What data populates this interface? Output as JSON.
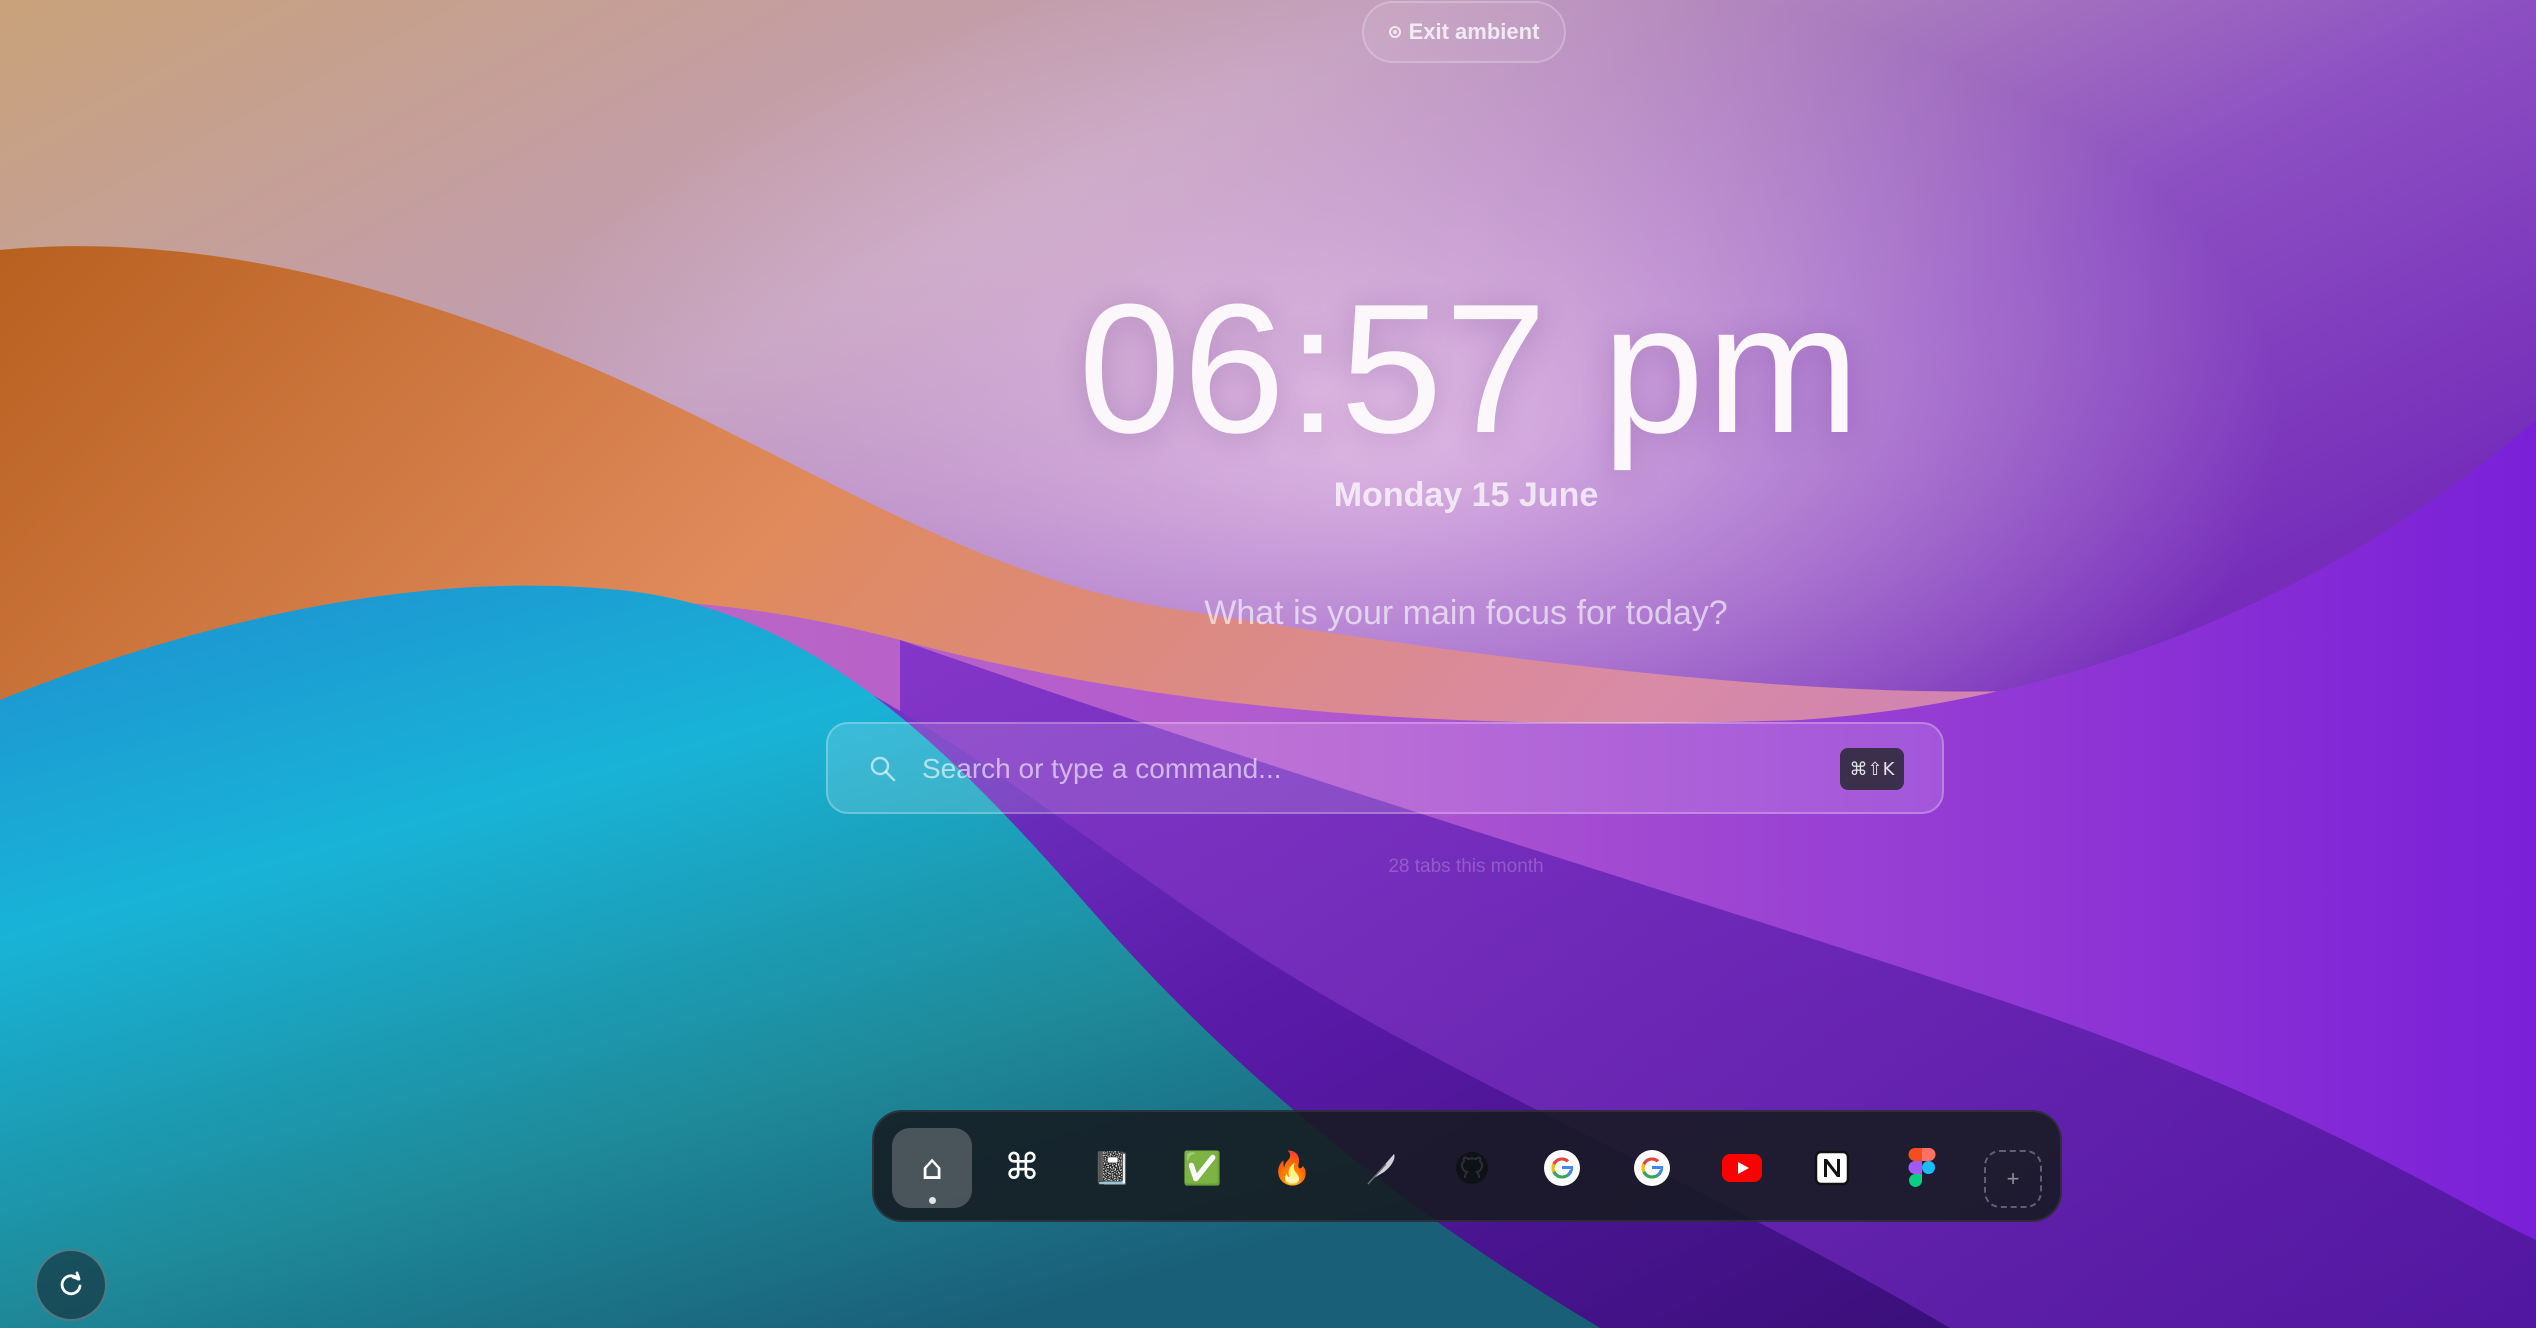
{
  "exit_ambient": {
    "label": "Exit ambient",
    "icon": "circle-dot-icon"
  },
  "clock": {
    "time": "06:57 pm",
    "date": "Monday 15 June"
  },
  "focus": {
    "prompt": "What is your main focus for today?"
  },
  "search": {
    "placeholder": "Search or type a command...",
    "shortcut": "⌘⇧K",
    "icon": "search-icon"
  },
  "stats": {
    "tabs_text": "28 tabs this month"
  },
  "dock": {
    "items": [
      {
        "name": "home",
        "icon": "home-icon",
        "glyph": "⌂",
        "active": true
      },
      {
        "name": "command",
        "icon": "command-icon",
        "glyph": "⌘"
      },
      {
        "name": "notebook",
        "icon": "notebook-icon",
        "glyph": "📓"
      },
      {
        "name": "tasks",
        "icon": "check-box-icon",
        "glyph": "✅"
      },
      {
        "name": "fire",
        "icon": "fire-icon",
        "glyph": "🔥"
      },
      {
        "name": "quill",
        "icon": "quill-icon",
        "glyph": "🪶"
      },
      {
        "name": "github",
        "icon": "github-icon"
      },
      {
        "name": "google-1",
        "icon": "google-icon"
      },
      {
        "name": "google-2",
        "icon": "google-icon"
      },
      {
        "name": "youtube",
        "icon": "youtube-icon"
      },
      {
        "name": "notion",
        "icon": "notion-icon"
      },
      {
        "name": "figma",
        "icon": "figma-icon"
      }
    ],
    "add_label": "+"
  },
  "refresh": {
    "icon": "refresh-icon"
  },
  "colors": {
    "accent_orange": "#d9782f",
    "accent_cyan": "#1bb3d8",
    "accent_purple": "#7a1fd0",
    "dock_bg": "#161a20"
  }
}
